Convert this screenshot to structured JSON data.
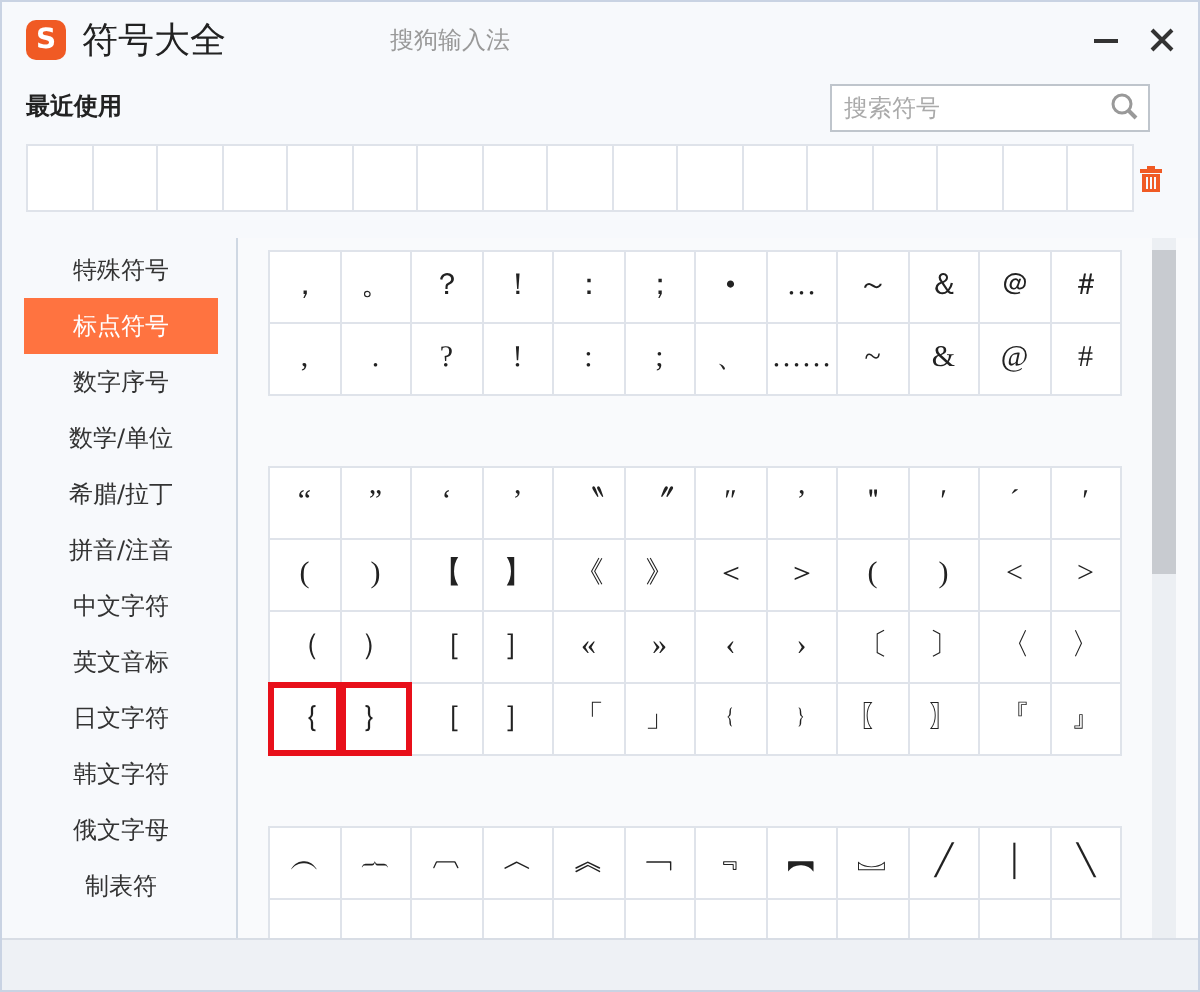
{
  "window": {
    "logo": "S",
    "title": "符号大全",
    "app_name": "搜狗输入法"
  },
  "recent": {
    "label": "最近使用",
    "search": {
      "placeholder": "搜索符号"
    }
  },
  "sidebar": {
    "items": [
      {
        "label": "特殊符号",
        "selected": false
      },
      {
        "label": "标点符号",
        "selected": true
      },
      {
        "label": "数字序号",
        "selected": false
      },
      {
        "label": "数学/单位",
        "selected": false
      },
      {
        "label": "希腊/拉丁",
        "selected": false
      },
      {
        "label": "拼音/注音",
        "selected": false
      },
      {
        "label": "中文字符",
        "selected": false
      },
      {
        "label": "英文音标",
        "selected": false
      },
      {
        "label": "日文字符",
        "selected": false
      },
      {
        "label": "韩文字符",
        "selected": false
      },
      {
        "label": "俄文字母",
        "selected": false
      },
      {
        "label": "制表符",
        "selected": false
      }
    ]
  },
  "groups": [
    {
      "rows": [
        [
          {
            "s": "，",
            "selected": false
          },
          {
            "s": "。",
            "selected": false
          },
          {
            "s": "？",
            "selected": false
          },
          {
            "s": "！",
            "selected": false
          },
          {
            "s": "：",
            "selected": false
          },
          {
            "s": "；",
            "selected": false
          },
          {
            "s": "•",
            "selected": false
          },
          {
            "s": "…",
            "selected": false
          },
          {
            "s": "～",
            "selected": false
          },
          {
            "s": "＆",
            "selected": false
          },
          {
            "s": "＠",
            "selected": false
          },
          {
            "s": "＃",
            "selected": false
          }
        ],
        [
          {
            "s": ",",
            "selected": false
          },
          {
            "s": ".",
            "selected": false
          },
          {
            "s": "?",
            "selected": false
          },
          {
            "s": "!",
            "selected": false
          },
          {
            "s": ":",
            "selected": false
          },
          {
            "s": ";",
            "selected": false
          },
          {
            "s": "、",
            "selected": false
          },
          {
            "s": "……",
            "selected": false
          },
          {
            "s": "~",
            "selected": false
          },
          {
            "s": "&",
            "selected": false
          },
          {
            "s": "@",
            "selected": false
          },
          {
            "s": "#",
            "selected": false
          }
        ]
      ]
    },
    {
      "rows": [
        [
          {
            "s": "“",
            "selected": false
          },
          {
            "s": "”",
            "selected": false
          },
          {
            "s": "‘",
            "selected": false
          },
          {
            "s": "’",
            "selected": false
          },
          {
            "s": "〝",
            "selected": false
          },
          {
            "s": "〞",
            "selected": false
          },
          {
            "s": "″",
            "selected": false
          },
          {
            "s": "’",
            "selected": false
          },
          {
            "s": "＂",
            "selected": false
          },
          {
            "s": "′",
            "selected": false
          },
          {
            "s": "´",
            "selected": false
          },
          {
            "s": "′",
            "selected": false
          }
        ],
        [
          {
            "s": "(",
            "selected": false
          },
          {
            "s": ")",
            "selected": false
          },
          {
            "s": "【",
            "selected": false
          },
          {
            "s": "】",
            "selected": false
          },
          {
            "s": "《",
            "selected": false
          },
          {
            "s": "》",
            "selected": false
          },
          {
            "s": "＜",
            "selected": false
          },
          {
            "s": "＞",
            "selected": false
          },
          {
            "s": "(",
            "selected": false
          },
          {
            "s": ")",
            "selected": false
          },
          {
            "s": "<",
            "selected": false
          },
          {
            "s": ">",
            "selected": false
          }
        ],
        [
          {
            "s": "（",
            "selected": false
          },
          {
            "s": "）",
            "selected": false
          },
          {
            "s": "［",
            "selected": false
          },
          {
            "s": "］",
            "selected": false
          },
          {
            "s": "«",
            "selected": false
          },
          {
            "s": "»",
            "selected": false
          },
          {
            "s": "‹",
            "selected": false
          },
          {
            "s": "›",
            "selected": false
          },
          {
            "s": "〔",
            "selected": false
          },
          {
            "s": "〕",
            "selected": false
          },
          {
            "s": "〈",
            "selected": false
          },
          {
            "s": "〉",
            "selected": false
          }
        ],
        [
          {
            "s": "｛",
            "selected": true
          },
          {
            "s": "｝",
            "selected": true
          },
          {
            "s": "［",
            "selected": false
          },
          {
            "s": "］",
            "selected": false
          },
          {
            "s": "「",
            "selected": false
          },
          {
            "s": "」",
            "selected": false
          },
          {
            "s": "﹛",
            "selected": false
          },
          {
            "s": "﹜",
            "selected": false
          },
          {
            "s": "〖",
            "selected": false
          },
          {
            "s": "〗",
            "selected": false
          },
          {
            "s": "『",
            "selected": false
          },
          {
            "s": "』",
            "selected": false
          }
        ]
      ]
    },
    {
      "rows": [
        [
          {
            "s": "︵",
            "selected": false
          },
          {
            "s": "︷",
            "selected": false
          },
          {
            "s": "︹",
            "selected": false
          },
          {
            "s": "︿",
            "selected": false
          },
          {
            "s": "︽",
            "selected": false
          },
          {
            "s": "﹁",
            "selected": false
          },
          {
            "s": "﹃",
            "selected": false
          },
          {
            "s": "︻",
            "selected": false
          },
          {
            "s": "︗",
            "selected": false
          },
          {
            "s": "╱",
            "selected": false
          },
          {
            "s": "│",
            "selected": false
          },
          {
            "s": "╲",
            "selected": false
          }
        ]
      ]
    }
  ]
}
